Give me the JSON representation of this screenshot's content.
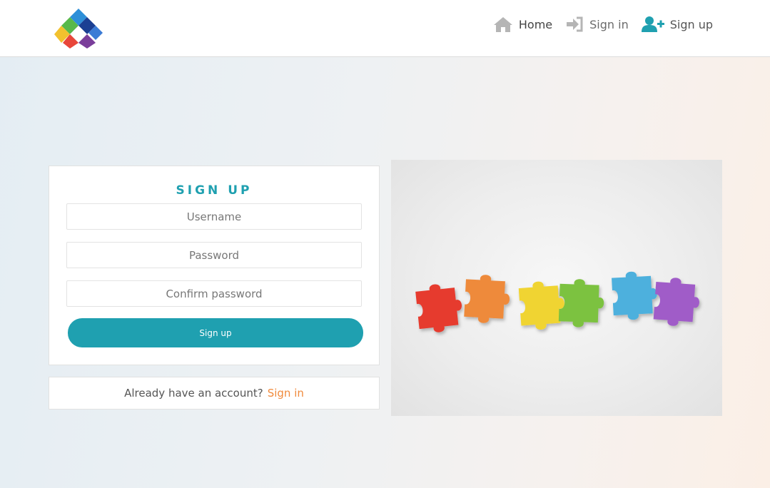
{
  "nav": {
    "home_label": "Home",
    "signin_label": "Sign in",
    "signup_label": "Sign up"
  },
  "form": {
    "title": "SIGN UP",
    "username_placeholder": "Username",
    "password_placeholder": "Password",
    "confirm_placeholder": "Confirm password",
    "submit_label": "Sign up"
  },
  "footer_card": {
    "prompt": "Already have an account?",
    "link_label": "Sign in"
  },
  "colors": {
    "accent": "#1fa0b0",
    "link": "#f08a3c",
    "puzzle": [
      "#e63b2e",
      "#ee8a3a",
      "#f0d431",
      "#7cc23f",
      "#4db0dd",
      "#a05cc8"
    ]
  },
  "icons": [
    "brand-logo",
    "home-icon",
    "sign-in-icon",
    "user-plus-icon"
  ]
}
